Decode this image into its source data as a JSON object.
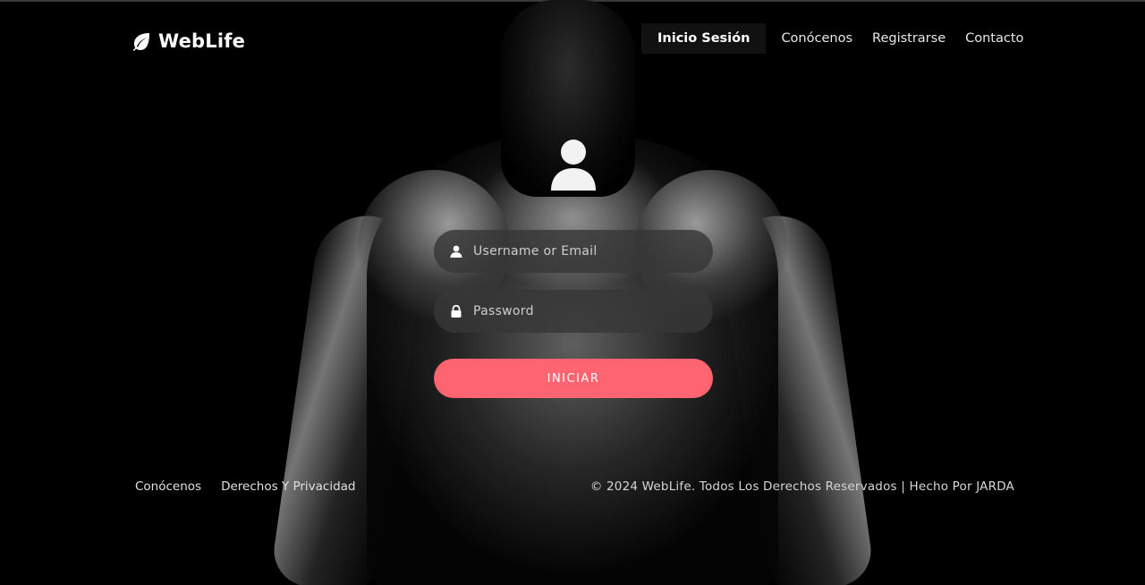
{
  "brand": {
    "name": "WebLife",
    "icon": "leaf-icon"
  },
  "nav": {
    "items": [
      {
        "label": "Inicio Sesión",
        "active": true
      },
      {
        "label": "Conócenos",
        "active": false
      },
      {
        "label": "Registrarse",
        "active": false
      },
      {
        "label": "Contacto",
        "active": false
      }
    ]
  },
  "login": {
    "avatar_icon": "user-avatar-icon",
    "username": {
      "placeholder": "Username or Email",
      "value": "",
      "icon": "user-icon"
    },
    "password": {
      "placeholder": "Password",
      "value": "",
      "icon": "lock-icon"
    },
    "submit_label": "INICIAR"
  },
  "footer": {
    "links": [
      "Conócenos",
      "Derechos Y Privacidad"
    ],
    "copyright": "© 2024 WebLife. Todos Los Derechos Reservados | Hecho Por JARDA"
  },
  "colors": {
    "background": "#000000",
    "accent": "#ff6470",
    "field_bg": "#373737",
    "active_nav_bg": "#111111"
  }
}
